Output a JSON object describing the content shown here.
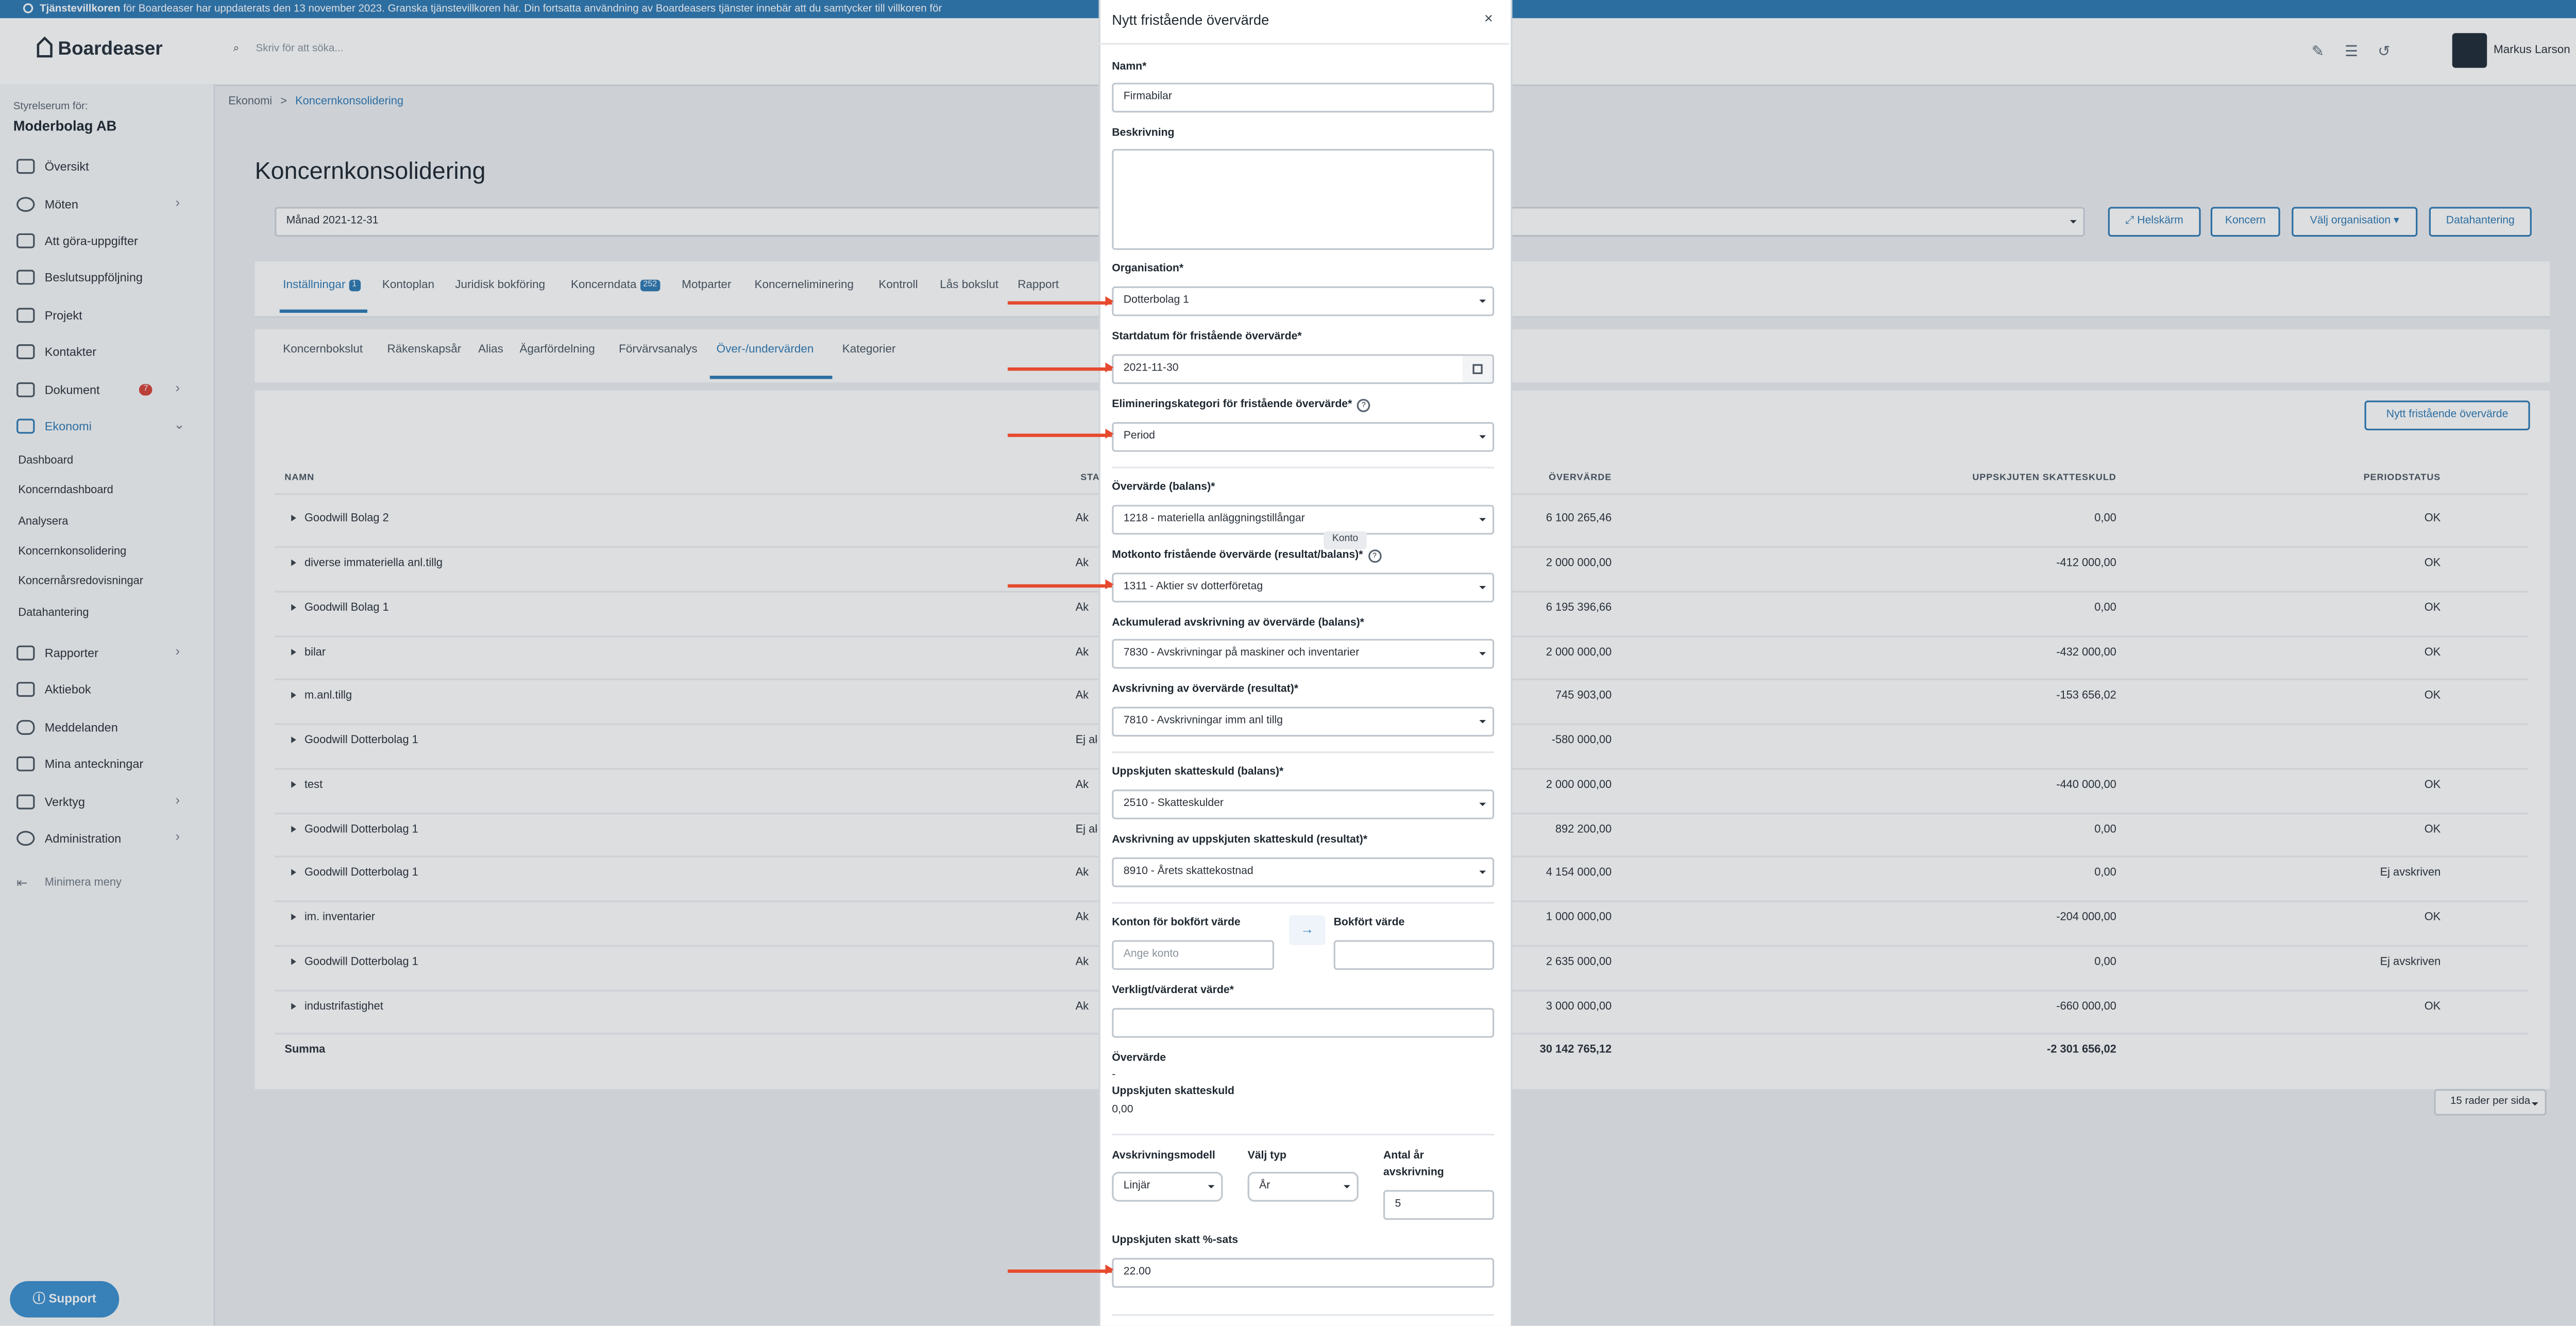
{
  "notice": {
    "bold": "Tjänstevillkoren",
    "text": " för Boardeaser har uppdaterats den 13 november 2023. Granska tjänstevillkoren här. Din fortsatta användning av Boardeasers tjänster innebär att du samtycker till villkoren för"
  },
  "header": {
    "logo": "Boardeaser",
    "search_placeholder": "Skriv för att söka...",
    "user_name": "Markus Larson"
  },
  "sidebar": {
    "room_label": "Styrelserum för:",
    "org_name": "Moderbolag AB",
    "items": [
      {
        "label": "Översikt",
        "icon": "home-icon"
      },
      {
        "label": "Möten",
        "icon": "clock-icon"
      },
      {
        "label": "Att göra-uppgifter",
        "icon": "list-icon"
      },
      {
        "label": "Beslutsuppföljning",
        "icon": "gavel-icon"
      },
      {
        "label": "Projekt",
        "icon": "network-icon"
      },
      {
        "label": "Kontakter",
        "icon": "contacts-icon"
      },
      {
        "label": "Dokument",
        "icon": "folder-icon",
        "badge": "7"
      },
      {
        "label": "Ekonomi",
        "icon": "chart-icon"
      }
    ],
    "sub_items": [
      "Dashboard",
      "Koncerndashboard",
      "Analysera",
      "Koncernkonsolidering",
      "Koncernårsredovisningar",
      "Datahantering"
    ],
    "items2": [
      {
        "label": "Rapporter",
        "icon": "layers-icon"
      },
      {
        "label": "Aktiebok",
        "icon": "briefcase-icon"
      },
      {
        "label": "Meddelanden",
        "icon": "chat-icon"
      },
      {
        "label": "Mina anteckningar",
        "icon": "pen-icon"
      },
      {
        "label": "Verktyg",
        "icon": "wrench-icon"
      },
      {
        "label": "Administration",
        "icon": "gear-icon"
      }
    ],
    "minimize": "Minimera meny",
    "support": "Support"
  },
  "main": {
    "breadcrumb": [
      "Ekonomi",
      "Koncernkonsolidering"
    ],
    "title": "Koncernkonsolidering",
    "period": "Månad 2021-12-31",
    "buttons": {
      "fullscreen": "Helskärm",
      "group": "Koncern",
      "choose_org": "Välj organisation",
      "data": "Datahantering"
    },
    "tabs": [
      {
        "label": "Inställningar",
        "badge": "1"
      },
      {
        "label": "Kontoplan"
      },
      {
        "label": "Juridisk bokföring"
      },
      {
        "label": "Koncerndata",
        "badge": "252"
      },
      {
        "label": "Motparter"
      },
      {
        "label": "Koncerneliminering"
      },
      {
        "label": "Kontroll"
      },
      {
        "label": "Lås bokslut"
      },
      {
        "label": "Rapport"
      }
    ],
    "subtabs": [
      "Koncernbokslut",
      "Räkenskapsår",
      "Alias",
      "Ägarfördelning",
      "Förvärvsanalys",
      "Över-/undervärden",
      "Kategorier"
    ],
    "new_button": "Nytt fristående övervärde",
    "columns": {
      "name": "NAMN",
      "status": "STAT",
      "overvalue": "ÖVERVÄRDE",
      "deferred_tax": "UPPSKJUTEN SKATTESKULD",
      "period_status": "PERIODSTATUS"
    },
    "rows": [
      {
        "name": "Goodwill Bolag 2",
        "status": "Ak",
        "value": "6 100 265,46",
        "tax": "0,00",
        "pstatus": "OK"
      },
      {
        "name": "diverse immateriella anl.tillg",
        "status": "Ak",
        "value": "2 000 000,00",
        "tax": "-412 000,00",
        "pstatus": "OK"
      },
      {
        "name": "Goodwill Bolag 1",
        "status": "Ak",
        "value": "6 195 396,66",
        "tax": "0,00",
        "pstatus": "OK"
      },
      {
        "name": "bilar",
        "status": "Ak",
        "value": "2 000 000,00",
        "tax": "-432 000,00",
        "pstatus": "OK"
      },
      {
        "name": "m.anl.tillg",
        "status": "Ak",
        "value": "745 903,00",
        "tax": "-153 656,02",
        "pstatus": "OK"
      },
      {
        "name": "Goodwill Dotterbolag 1",
        "status": "Ej ak",
        "value": "-580 000,00",
        "tax": "",
        "pstatus": ""
      },
      {
        "name": "test",
        "status": "Ak",
        "value": "2 000 000,00",
        "tax": "-440 000,00",
        "pstatus": "OK"
      },
      {
        "name": "Goodwill Dotterbolag 1",
        "status": "Ej ak",
        "value": "892 200,00",
        "tax": "0,00",
        "pstatus": "OK"
      },
      {
        "name": "Goodwill Dotterbolag 1",
        "status": "Ak",
        "value": "4 154 000,00",
        "tax": "0,00",
        "pstatus": "Ej avskriven"
      },
      {
        "name": "im. inventarier",
        "status": "Ak",
        "value": "1 000 000,00",
        "tax": "-204 000,00",
        "pstatus": "OK"
      },
      {
        "name": "Goodwill Dotterbolag 1",
        "status": "Ak",
        "value": "2 635 000,00",
        "tax": "0,00",
        "pstatus": "Ej avskriven"
      },
      {
        "name": "industrifastighet",
        "status": "Ak",
        "value": "3 000 000,00",
        "tax": "-660 000,00",
        "pstatus": "OK"
      }
    ],
    "sum": {
      "label": "Summa",
      "value": "30 142 765,12",
      "tax": "-2 301 656,02"
    },
    "pager": "15 rader per sida"
  },
  "modal": {
    "title": "Nytt fristående övervärde",
    "close": "×",
    "name_label": "Namn*",
    "name_value": "Firmabilar",
    "desc_label": "Beskrivning",
    "org_label": "Organisation*",
    "org_value": "Dotterbolag 1",
    "start_label": "Startdatum för fristående övervärde*",
    "start_value": "2021-11-30",
    "elim_label": "Elimineringskategori för fristående övervärde*",
    "elim_value": "Period",
    "ov_label": "Övervärde (balans)*",
    "ov_value": "1218 - materiella anläggningstillångar",
    "tooltip": "Konto",
    "mot_label": "Motkonto fristående övervärde (resultat/balans)*",
    "mot_value": "1311 - Aktier sv dotterföretag",
    "acc_label": "Ackumulerad avskrivning av övervärde (balans)*",
    "acc_value": "7830 - Avskrivningar på maskiner och inventarier",
    "dep_label": "Avskrivning av övervärde (resultat)*",
    "dep_value": "7810 - Avskrivningar imm anl tillg",
    "dtb_label": "Uppskjuten skatteskuld (balans)*",
    "dtb_value": "2510 - Skatteskulder",
    "dtr_label": "Avskrivning av uppskjuten skatteskuld (resultat)*",
    "dtr_value": "8910 - Årets skattekostnad",
    "accounts_label": "Konton för bokfört värde",
    "accounts_placeholder": "Ange konto",
    "arrow": "→",
    "book_label": "Bokfört värde",
    "real_label": "Verkligt/värderat värde*",
    "ov_summary_label": "Övervärde",
    "ov_summary_value": "-",
    "tax_summary_label": "Uppskjuten skatteskuld",
    "tax_summary_value": "0,00",
    "model_label": "Avskrivningsmodell",
    "model_value": "Linjär",
    "type_label": "Välj typ",
    "type_value": "År",
    "years_label_1": "Antal år",
    "years_label_2": "avskrivning",
    "years_value": "5",
    "rate_label": "Uppskjuten skatt %-sats",
    "rate_value": "22.00"
  }
}
